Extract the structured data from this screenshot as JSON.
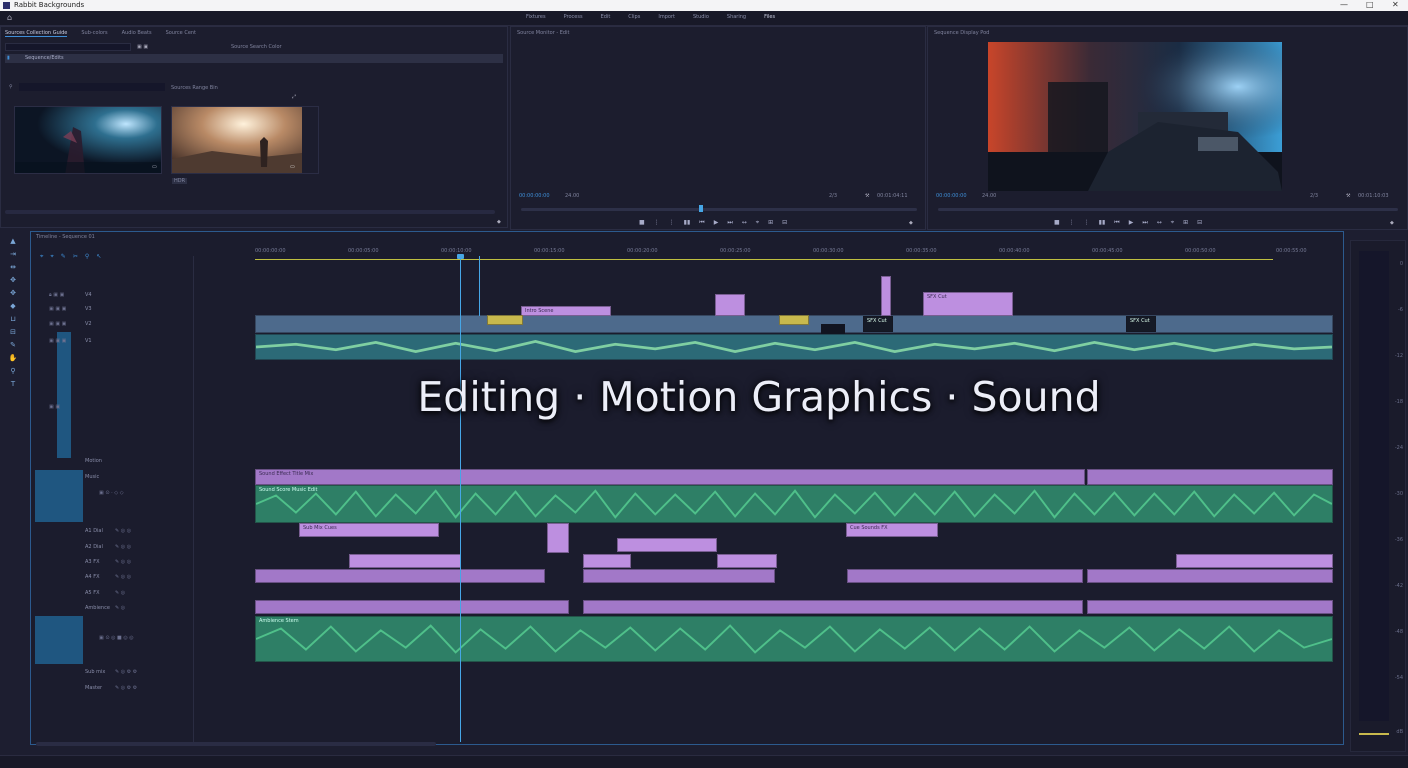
{
  "window": {
    "title": "Rabbit Backgrounds",
    "controls": [
      "—",
      "□",
      "✕"
    ]
  },
  "menubar": {
    "home_icon": "home-icon",
    "items": [
      "Fixtures",
      "Process",
      "Edit",
      "Clips",
      "Import",
      "Studio",
      "Sharing",
      "Files"
    ],
    "active_index": 7
  },
  "project": {
    "tabs": [
      "Sources Collection Guide",
      "Sub-colors",
      "Audio Beats",
      "Source Cent"
    ],
    "bin_label": "Source Search Color",
    "selected_item": "Sequence/Edits",
    "search_label": "Sources Range Bin",
    "thumb_badge": "HDR"
  },
  "source_monitor": {
    "label": "Source Monitor - Edit",
    "timecode_in": "00:00:00:00",
    "timecode_field": "24.00",
    "timecode_out": "2/3",
    "timecode_duration": "00:01:04:11"
  },
  "program_monitor": {
    "label": "Sequence Display Pod",
    "timecode_in": "00:00:00:00",
    "timecode_field": "24.00",
    "timecode_out": "2/3",
    "timecode_duration": "00:01:10:03"
  },
  "transport": [
    "■",
    "⋮",
    "⋮",
    "▮▮",
    "⏮",
    "▶",
    "⏭",
    "↔",
    "⌖",
    "⊞",
    "⊟"
  ],
  "timeline": {
    "title": "Timeline - Sequence 01",
    "tools": [
      "⌖",
      "⌖",
      "✎",
      "✂",
      "⚲",
      "↖"
    ],
    "ruler": [
      "00:00:00:00",
      "00:00:05:00",
      "00:00:10:00",
      "00:00:15:00",
      "00:00:20:00",
      "00:00:25:00",
      "00:00:30:00",
      "00:00:35:00",
      "00:00:40:00",
      "00:00:45:00",
      "00:00:50:00",
      "00:00:55:00"
    ],
    "tracks": [
      {
        "name": "V4",
        "kind": "video"
      },
      {
        "name": "V3",
        "kind": "video"
      },
      {
        "name": "V2",
        "kind": "video"
      },
      {
        "name": "V1",
        "kind": "video"
      },
      {
        "name": "Motion",
        "kind": "graphics"
      },
      {
        "name": "Music",
        "kind": "audio"
      },
      {
        "name": "A1 Dial",
        "kind": "audio"
      },
      {
        "name": "A2 Dial",
        "kind": "audio"
      },
      {
        "name": "A3 FX",
        "kind": "audio"
      },
      {
        "name": "A4 FX",
        "kind": "audio"
      },
      {
        "name": "A5 FX",
        "kind": "audio"
      },
      {
        "name": "Ambience",
        "kind": "audio"
      },
      {
        "name": "Sub mix",
        "kind": "audio"
      },
      {
        "name": "Master",
        "kind": "audio"
      }
    ],
    "clip_labels": {
      "titles": "Sound Effect Title Mix",
      "music": "Sound Score Music Edit",
      "fx1": "Sub Mix Cues",
      "fx2": "Cue Sounds FX",
      "amb": "Ambience Stem",
      "t1": "Intro Scene",
      "t2": "SFX Cut",
      "t3": "SFX Cut",
      "t4": "SFX Cut"
    }
  },
  "overlay_text": "Editing · Motion Graphics · Sound",
  "meters": {
    "scale": [
      "0",
      "-6",
      "-12",
      "-18",
      "-24",
      "-30",
      "-36",
      "-42",
      "-48",
      "-54",
      "dB"
    ]
  }
}
